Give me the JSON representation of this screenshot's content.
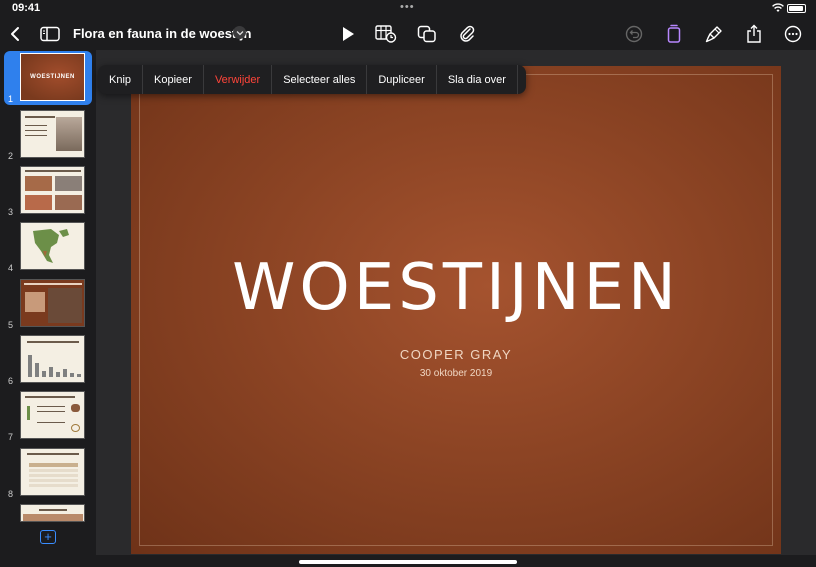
{
  "status_bar": {
    "time": "09:41",
    "multitask_dots": "•••"
  },
  "toolbar": {
    "document_title": "Flora en fauna in de woestijn",
    "icons": [
      "back-chevron-icon",
      "sidebar-icon",
      "play-icon",
      "table-chart-icon",
      "shapes-icon",
      "paperclip-icon",
      "undo-icon",
      "format-icon",
      "paintbrush-icon",
      "share-icon",
      "more-icon"
    ]
  },
  "context_menu": {
    "items": [
      "Knip",
      "Kopieer",
      "Verwijder",
      "Selecteer alles",
      "Dupliceer",
      "Sla dia over"
    ],
    "more_glyph": "›",
    "destructive_color": "#ff453a"
  },
  "navigator": {
    "slides": [
      {
        "number": "1",
        "thumb_title": "WOESTIJNEN",
        "selected": true
      },
      {
        "number": "2",
        "thumb_title": ""
      },
      {
        "number": "3",
        "thumb_title": ""
      },
      {
        "number": "4",
        "thumb_title": ""
      },
      {
        "number": "5",
        "thumb_title": ""
      },
      {
        "number": "6",
        "thumb_title": ""
      },
      {
        "number": "7",
        "thumb_title": ""
      },
      {
        "number": "8",
        "thumb_title": ""
      }
    ],
    "add_glyph": "+",
    "selection_color": "#2f80ed"
  },
  "slide": {
    "title": "WOESTIJNEN",
    "author": "COOPER GRAY",
    "date": "30 oktober 2019",
    "background_color": "#8c4424"
  }
}
